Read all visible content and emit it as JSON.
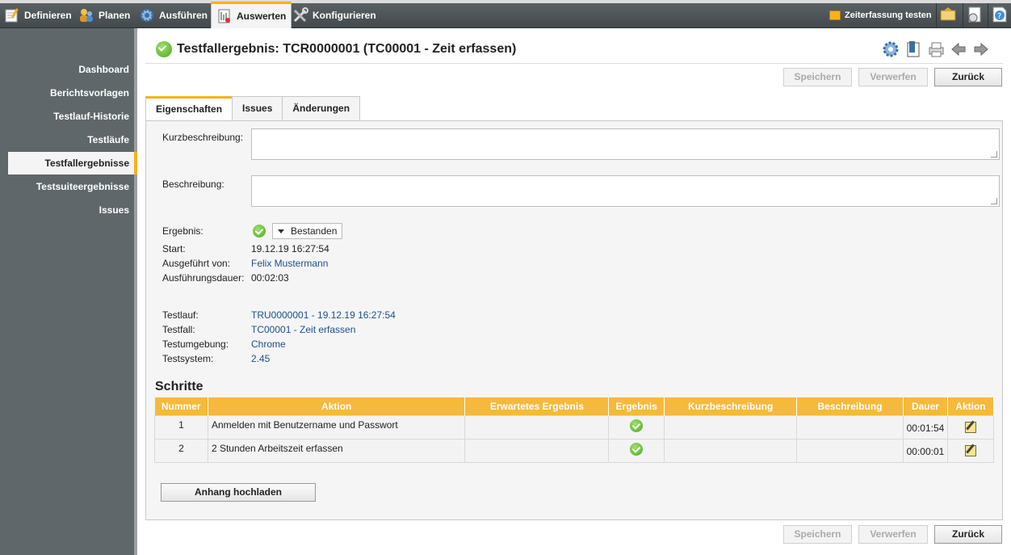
{
  "topnav": {
    "definieren": "Definieren",
    "planen": "Planen",
    "ausfuehren": "Ausführen",
    "auswerten": "Auswerten",
    "konfigurieren": "Konfigurieren",
    "zeiterfassung": "Zeiterfassung testen"
  },
  "sidebar": {
    "items": [
      {
        "label": "Dashboard"
      },
      {
        "label": "Berichtsvorlagen"
      },
      {
        "label": "Testlauf-Historie"
      },
      {
        "label": "Testläufe"
      },
      {
        "label": "Testfallergebnisse"
      },
      {
        "label": "Testsuiteergebnisse"
      },
      {
        "label": "Issues"
      }
    ]
  },
  "header": {
    "title": "Testfallergebnis: TCR0000001 (TC00001 - Zeit erfassen)"
  },
  "buttons": {
    "save": "Speichern",
    "discard": "Verwerfen",
    "back": "Zurück",
    "upload": "Anhang hochladen"
  },
  "tabs": [
    "Eigenschaften",
    "Issues",
    "Änderungen"
  ],
  "form": {
    "kurzbeschreibung_label": "Kurzbeschreibung:",
    "kurzbeschreibung_value": "",
    "beschreibung_label": "Beschreibung:",
    "beschreibung_value": "",
    "ergebnis_label": "Ergebnis:",
    "ergebnis_value": "Bestanden",
    "start_label": "Start:",
    "start_value": "19.12.19 16:27:54",
    "ausgefuehrt_label": "Ausgeführt von:",
    "ausgefuehrt_value": "Felix Mustermann",
    "dauer_label": "Ausführungsdauer:",
    "dauer_value": "00:02:03",
    "testlauf_label": "Testlauf:",
    "testlauf_value": "TRU0000001 - 19.12.19 16:27:54",
    "testfall_label": "Testfall:",
    "testfall_value": "TC00001 - Zeit erfassen",
    "testumgebung_label": "Testumgebung:",
    "testumgebung_value": "Chrome",
    "testsystem_label": "Testsystem:",
    "testsystem_value": "2.45"
  },
  "steps": {
    "title": "Schritte",
    "columns": [
      "Nummer",
      "Aktion",
      "Erwartetes Ergebnis",
      "Ergebnis",
      "Kurzbeschreibung",
      "Beschreibung",
      "Dauer",
      "Aktion"
    ],
    "rows": [
      {
        "nummer": "1",
        "aktion": "Anmelden mit Benutzername und Passwort",
        "erwartet": "",
        "kurz": "",
        "beschreibung": "",
        "dauer": "00:01:54"
      },
      {
        "nummer": "2",
        "aktion": "2 Stunden Arbeitszeit erfassen",
        "erwartet": "",
        "kurz": "",
        "beschreibung": "",
        "dauer": "00:00:01"
      }
    ]
  },
  "colors": {
    "accent": "#f5b21f",
    "link": "#1f4e8c",
    "topbar": "#4a5155"
  }
}
